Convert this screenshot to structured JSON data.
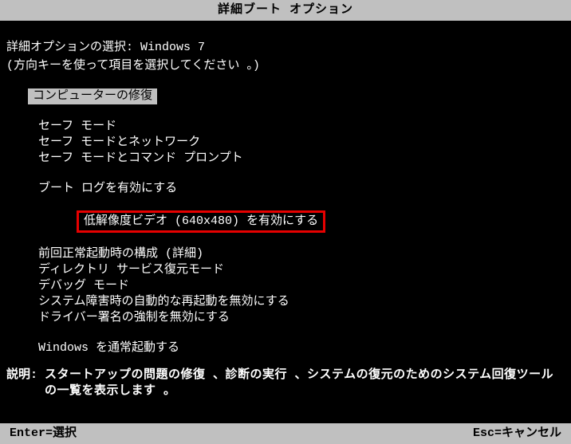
{
  "title": "詳細ブート オプション",
  "prompt": "詳細オプションの選択: Windows 7",
  "hint": "(方向キーを使って項目を選択してください 。)",
  "selected": "コンピューターの修復",
  "options_block1": [
    "セーフ モード",
    "セーフ モードとネットワーク",
    "セーフ モードとコマンド プロンプト"
  ],
  "options_block2": [
    "ブート ログを有効にする",
    "低解像度ビデオ (640x480) を有効にする",
    "前回正常起動時の構成 (詳細)",
    "ディレクトリ サービス復元モード",
    "デバッグ モード",
    "システム障害時の自動的な再起動を無効にする",
    "ドライバー署名の強制を無効にする"
  ],
  "options_block3": [
    "Windows を通常起動する"
  ],
  "highlighted_index": 1,
  "desc_label": "説明: ",
  "desc_text": "スタートアップの問題の修復 、診断の実行 、システムの復元のためのシステム回復ツールの一覧を表示します 。",
  "footer_left": "Enter=選択",
  "footer_right": "Esc=キャンセル"
}
